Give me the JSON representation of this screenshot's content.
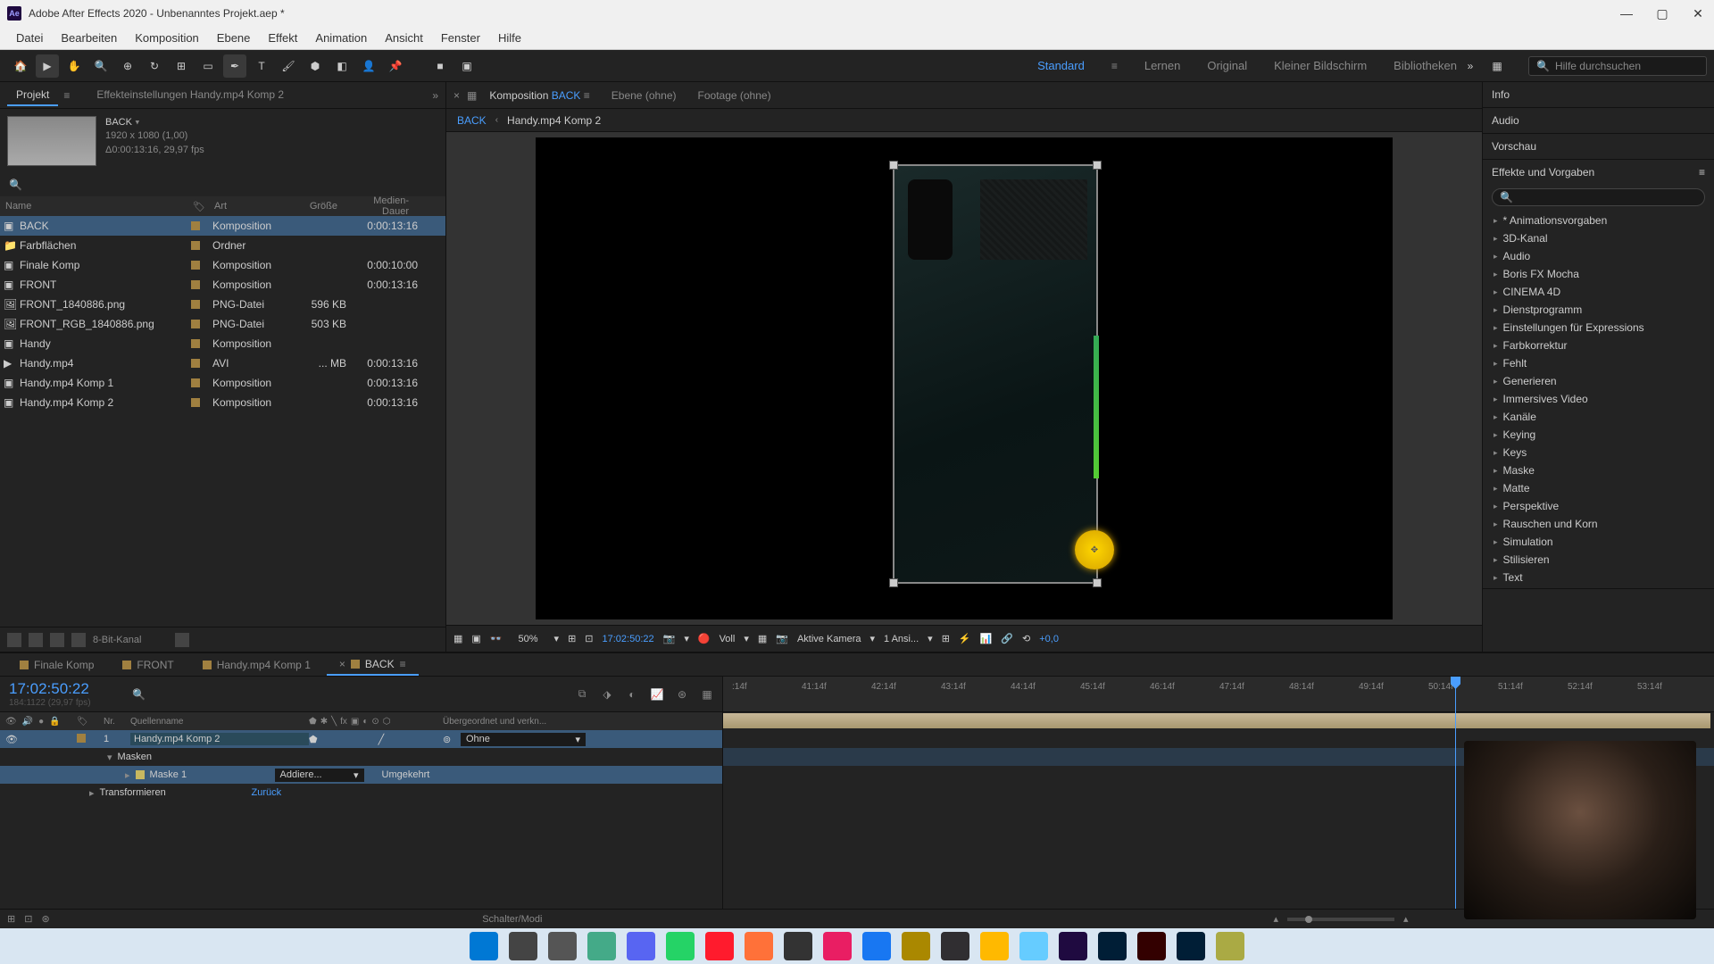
{
  "titlebar": {
    "title": "Adobe After Effects 2020 - Unbenanntes Projekt.aep *"
  },
  "menu": [
    "Datei",
    "Bearbeiten",
    "Komposition",
    "Ebene",
    "Effekt",
    "Animation",
    "Ansicht",
    "Fenster",
    "Hilfe"
  ],
  "workspaces": {
    "items": [
      "Standard",
      "Lernen",
      "Original",
      "Kleiner Bildschirm",
      "Bibliotheken"
    ],
    "active": 0,
    "search_placeholder": "Hilfe durchsuchen"
  },
  "project_panel": {
    "tab": "Projekt",
    "effect_settings": "Effekteinstellungen Handy.mp4 Komp 2",
    "thumb_name": "BACK",
    "thumb_dim": "1920 x 1080 (1,00)",
    "thumb_dur": "Δ0:00:13:16, 29,97 fps",
    "search_icon": "🔍",
    "headers": {
      "name": "Name",
      "type": "Art",
      "size": "Größe",
      "duration": "Medien-Dauer"
    },
    "items": [
      {
        "name": "BACK",
        "type": "Komposition",
        "size": "",
        "duration": "0:00:13:16",
        "tag": "#a08040",
        "selected": true,
        "icon": "comp"
      },
      {
        "name": "Farbflächen",
        "type": "Ordner",
        "size": "",
        "duration": "",
        "tag": "#a08040",
        "icon": "folder"
      },
      {
        "name": "Finale Komp",
        "type": "Komposition",
        "size": "",
        "duration": "0:00:10:00",
        "tag": "#a08040",
        "icon": "comp"
      },
      {
        "name": "FRONT",
        "type": "Komposition",
        "size": "",
        "duration": "0:00:13:16",
        "tag": "#a08040",
        "icon": "comp"
      },
      {
        "name": "FRONT_1840886.png",
        "type": "PNG-Datei",
        "size": "596 KB",
        "duration": "",
        "tag": "#a08040",
        "icon": "png"
      },
      {
        "name": "FRONT_RGB_1840886.png",
        "type": "PNG-Datei",
        "size": "503 KB",
        "duration": "",
        "tag": "#a08040",
        "icon": "png"
      },
      {
        "name": "Handy",
        "type": "Komposition",
        "size": "",
        "duration": "",
        "tag": "#a08040",
        "icon": "comp"
      },
      {
        "name": "Handy.mp4",
        "type": "AVI",
        "size": "... MB",
        "duration": "0:00:13:16",
        "tag": "#a08040",
        "icon": "avi"
      },
      {
        "name": "Handy.mp4 Komp 1",
        "type": "Komposition",
        "size": "",
        "duration": "0:00:13:16",
        "tag": "#a08040",
        "icon": "comp"
      },
      {
        "name": "Handy.mp4 Komp 2",
        "type": "Komposition",
        "size": "",
        "duration": "0:00:13:16",
        "tag": "#a08040",
        "icon": "comp"
      }
    ],
    "footer_bit": "8-Bit-Kanal"
  },
  "composition": {
    "tabs": [
      {
        "label": "Komposition",
        "value": "BACK",
        "active": true
      },
      {
        "label": "Ebene",
        "value": "(ohne)"
      },
      {
        "label": "Footage",
        "value": "(ohne)"
      }
    ],
    "crumb": [
      "BACK",
      "Handy.mp4 Komp 2"
    ],
    "footer": {
      "zoom": "50%",
      "timecode": "17:02:50:22",
      "resolution": "Voll",
      "camera": "Aktive Kamera",
      "view": "1 Ansi...",
      "exposure": "+0,0"
    }
  },
  "right_panels": {
    "info": "Info",
    "audio": "Audio",
    "preview": "Vorschau",
    "effects": "Effekte und Vorgaben",
    "effects_list": [
      "* Animationsvorgaben",
      "3D-Kanal",
      "Audio",
      "Boris FX Mocha",
      "CINEMA 4D",
      "Dienstprogramm",
      "Einstellungen für Expressions",
      "Farbkorrektur",
      "Fehlt",
      "Generieren",
      "Immersives Video",
      "Kanäle",
      "Keying",
      "Keys",
      "Maske",
      "Matte",
      "Perspektive",
      "Rauschen und Korn",
      "Simulation",
      "Stilisieren",
      "Text"
    ]
  },
  "timeline": {
    "tabs": [
      {
        "name": "Finale Komp"
      },
      {
        "name": "FRONT"
      },
      {
        "name": "Handy.mp4 Komp 1"
      },
      {
        "name": "BACK",
        "active": true
      }
    ],
    "timecode": "17:02:50:22",
    "frames": "184:1122 (29,97 fps)",
    "colhead": {
      "nr": "Nr.",
      "source": "Quellenname",
      "parent": "Übergeordnet und verkn..."
    },
    "layer": {
      "nr": "1",
      "name": "Handy.mp4 Komp 2",
      "parent": "Ohne"
    },
    "masks_label": "Masken",
    "mask1": "Maske 1",
    "mask_mode": "Addiere...",
    "mask_invert": "Umgekehrt",
    "transform": "Transformieren",
    "reset": "Zurück",
    "ruler_ticks": [
      ":14f",
      "41:14f",
      "42:14f",
      "43:14f",
      "44:14f",
      "45:14f",
      "46:14f",
      "47:14f",
      "48:14f",
      "49:14f",
      "50:14f",
      "51:14f",
      "52:14f",
      "53:14f"
    ],
    "footer": "Schalter/Modi"
  },
  "taskbar": {
    "icons": [
      "windows",
      "search",
      "taskview",
      "explorer",
      "teams",
      "whatsapp",
      "opera",
      "firefox",
      "app1",
      "messenger",
      "facebook",
      "app2",
      "obs",
      "folder",
      "notepad",
      "ae",
      "ps",
      "ai",
      "lr",
      "app3"
    ],
    "colors": [
      "#0078d4",
      "#444",
      "#555",
      "#4a8",
      "#5865f2",
      "#25d366",
      "#ff1b2d",
      "#ff7139",
      "#333",
      "#e91e63",
      "#1877f2",
      "#a80",
      "#302e31",
      "#ffb900",
      "#6cf",
      "#1f0a40",
      "#001e36",
      "#330000",
      "#001e36",
      "#aa4"
    ]
  }
}
